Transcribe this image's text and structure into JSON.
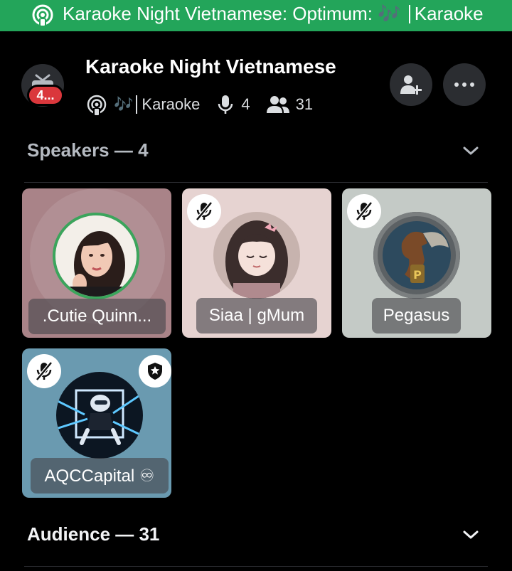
{
  "banner": {
    "text_main": "Karaoke Night Vietnamese: Optimum: ",
    "text_music": "🎶",
    "text_tail": "Karaoke",
    "color": "#23a55a"
  },
  "header": {
    "title": "Karaoke Night Vietnamese",
    "topic_music": "🎶",
    "topic": "Karaoke",
    "speaker_count": "4",
    "listener_count": "31",
    "notification_badge": "4..."
  },
  "sections": {
    "speakers_label": "Speakers — 4",
    "audience_label": "Audience — 31"
  },
  "speakers": [
    {
      "name": ".Cutie Quinn...",
      "muted": false,
      "speaking": true,
      "tile_color": "#a98388"
    },
    {
      "name": "Siaa | gMum",
      "muted": true,
      "speaking": false,
      "tile_color": "#e6d3d1"
    },
    {
      "name": "Pegasus",
      "muted": true,
      "speaking": false,
      "tile_color": "#c4cac6"
    },
    {
      "name": "AQCCapital ♾",
      "muted": true,
      "speaking": false,
      "moderator": true,
      "tile_color": "#6a9ab0"
    }
  ],
  "icons": {
    "stage": "stage-broadcast-icon",
    "mic": "microphone-icon",
    "people": "people-icon",
    "invite": "add-friend-icon",
    "more": "more-horizontal-icon",
    "muted": "mic-off-icon",
    "moderator": "shield-star-icon"
  },
  "colors": {
    "speaking_ring": "#3ba55c",
    "badge_red": "#da373c"
  }
}
